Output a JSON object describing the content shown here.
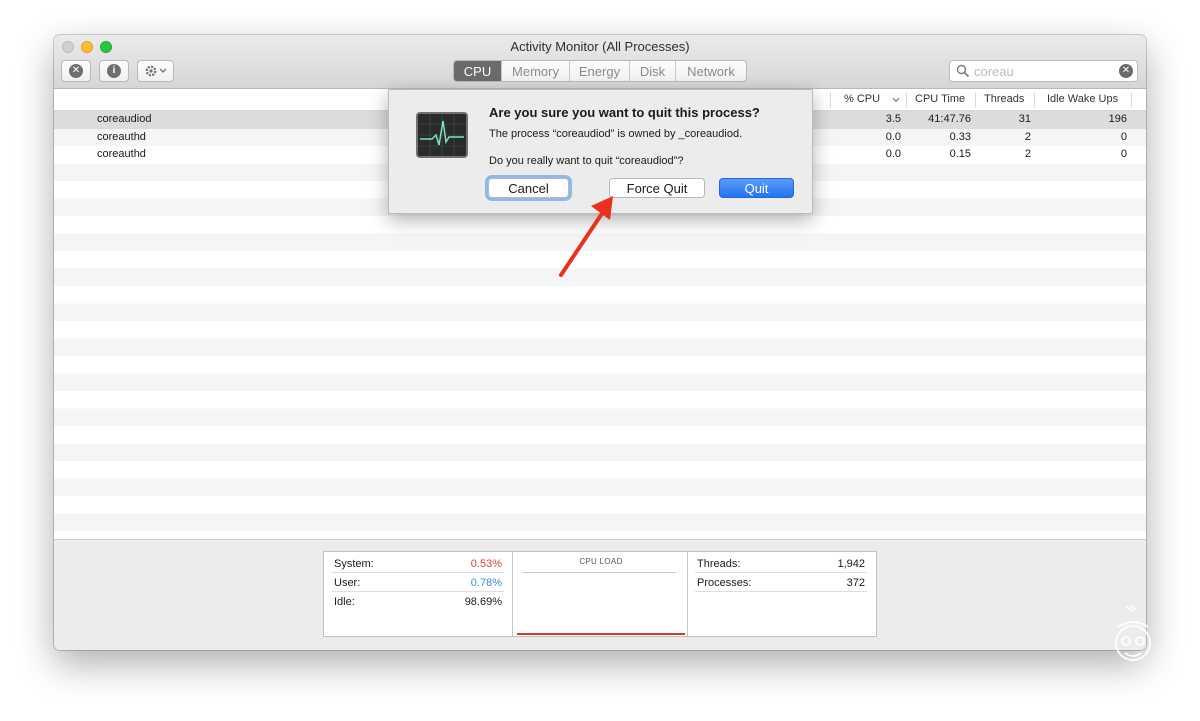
{
  "window": {
    "title": "Activity Monitor (All Processes)"
  },
  "toolbar": {
    "tabs": [
      {
        "label": "CPU",
        "active": true
      },
      {
        "label": "Memory",
        "active": false
      },
      {
        "label": "Energy",
        "active": false
      },
      {
        "label": "Disk",
        "active": false
      },
      {
        "label": "Network",
        "active": false
      }
    ],
    "search_value": "coreau",
    "icons": {
      "stop": "stop-process-icon",
      "info": "info-icon",
      "gear": "gear-icon",
      "search": "search-icon",
      "clear": "clear-search-icon"
    }
  },
  "table": {
    "columns": [
      "% CPU",
      "CPU Time",
      "Threads",
      "Idle Wake Ups"
    ],
    "rows": [
      {
        "name": "coreaudiod",
        "cpu": "3.5",
        "time": "41:47.76",
        "threads": "31",
        "wakeups": "196"
      },
      {
        "name": "coreauthd",
        "cpu": "0.0",
        "time": "0.33",
        "threads": "2",
        "wakeups": "0"
      },
      {
        "name": "coreauthd",
        "cpu": "0.0",
        "time": "0.15",
        "threads": "2",
        "wakeups": "0"
      }
    ]
  },
  "dialog": {
    "title": "Are you sure you want to quit this process?",
    "message": "The process “coreaudiod” is owned by _coreaudiod.",
    "question": "Do you really want to quit “coreaudiod”?",
    "cancel": "Cancel",
    "force_quit": "Force Quit",
    "quit": "Quit"
  },
  "stats": {
    "system_label": "System:",
    "system_value": "0.53%",
    "user_label": "User:",
    "user_value": "0.78%",
    "idle_label": "Idle:",
    "idle_value": "98.69%",
    "cpu_load_title": "CPU LOAD",
    "threads_label": "Threads:",
    "threads_value": "1,942",
    "processes_label": "Processes:",
    "processes_value": "372"
  },
  "colors": {
    "system": "#d6453a",
    "user": "#3a8ee6",
    "quit_button": "#2374ee",
    "arrow": "#e8321f"
  }
}
